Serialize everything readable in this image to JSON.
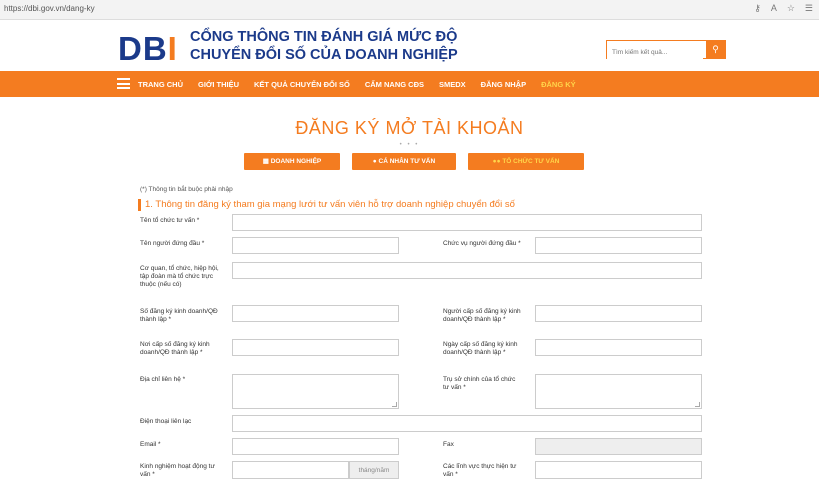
{
  "browser": {
    "url": "https://dbi.gov.vn/dang-ky"
  },
  "header": {
    "logo_text": "DB",
    "logo_i": "I",
    "brand_line1": "CỔNG THÔNG TIN ĐÁNH GIÁ MỨC ĐỘ",
    "brand_line2": "CHUYỂN ĐỔI SỐ CỦA DOANH NGHIỆP",
    "search_placeholder": "Tìm kiếm kết quả...",
    "accent": "#f47c20",
    "brand_color": "#1b3a8a"
  },
  "nav": {
    "items": [
      "TRANG CHỦ",
      "GIỚI THIỆU",
      "KẾT QUẢ CHUYỂN ĐỔI SỐ",
      "CẨM NANG CĐS",
      "SMEDX",
      "ĐĂNG NHẬP",
      "ĐĂNG KÝ"
    ]
  },
  "page": {
    "title": "ĐĂNG KÝ MỞ TÀI KHOẢN",
    "dots": "• • •",
    "tabs": [
      "DOANH NGHIỆP",
      "CÁ NHÂN TƯ VẤN",
      "TỔ CHỨC TƯ VẤN"
    ],
    "required_note": "(*) Thông tin bắt buộc phải nhập",
    "section1": "1. Thông tin đăng ký tham gia mạng lưới tư vấn viên hỗ trợ doanh nghiệp chuyển đổi số"
  },
  "form": {
    "org_name": "Tên tổ chức tư vấn *",
    "head_name": "Tên người đứng đầu *",
    "head_position": "Chức vụ người đứng đầu *",
    "parent_org": "Cơ quan, tổ chức, hiệp hội, tập đoàn mà tổ chức trực thuộc (nếu có)",
    "license_no": "Số đăng ký kinh doanh/QĐ thành lập *",
    "license_signer": "Người cấp số đăng ký kinh doanh/QĐ thành lập *",
    "license_place": "Nơi cấp số đăng ký kinh doanh/QĐ thành lập *",
    "license_date": "Ngày cấp số đăng ký kinh doanh/QĐ thành lập *",
    "contact_address": "Địa chỉ liên hệ *",
    "head_office": "Trụ sở chính của tổ chức tư vấn *",
    "phone": "Điện thoại liên lạc",
    "email": "Email *",
    "fax": "Fax",
    "experience": "Kinh nghiệm hoạt động tư vấn *",
    "experience_unit": "tháng/năm",
    "fields": "Các lĩnh vực thực hiện tư vấn *"
  }
}
